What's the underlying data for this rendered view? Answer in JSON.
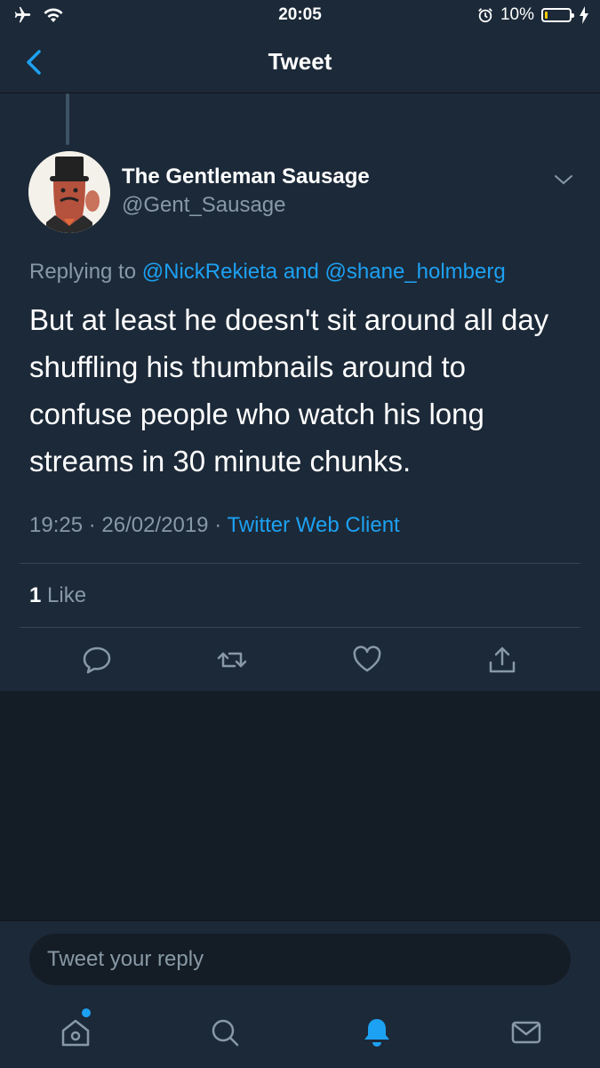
{
  "status_bar": {
    "time": "20:05",
    "battery_text": "10%",
    "battery_level": 0.1
  },
  "header": {
    "title": "Tweet"
  },
  "tweet": {
    "author_name": "The Gentleman Sausage",
    "author_handle": "@Gent_Sausage",
    "replying_prefix": "Replying to",
    "reply_to_1": "@NickRekieta",
    "reply_joiner": "and",
    "reply_to_2": "@shane_holmberg",
    "text": "But at least he doesn't sit around all day shuffling his thumbnails around to confuse people who watch his long streams in 30 minute chunks.",
    "time": "19:25",
    "date": "26/02/2019",
    "client": "Twitter Web Client",
    "separator": "·",
    "like_count": "1",
    "like_label": "Like"
  },
  "compose": {
    "placeholder": "Tweet your reply"
  },
  "colors": {
    "accent": "#1da1f2",
    "background": "#141d26",
    "panel": "#1c2938",
    "muted": "#8899a6"
  },
  "icons": {
    "status": [
      "airplane-icon",
      "wifi-icon",
      "alarm-icon",
      "battery-icon",
      "charging-icon"
    ],
    "actions": [
      "reply-icon",
      "retweet-icon",
      "like-icon",
      "share-icon"
    ],
    "tabs": [
      "home-icon",
      "search-icon",
      "notifications-icon",
      "messages-icon"
    ]
  }
}
